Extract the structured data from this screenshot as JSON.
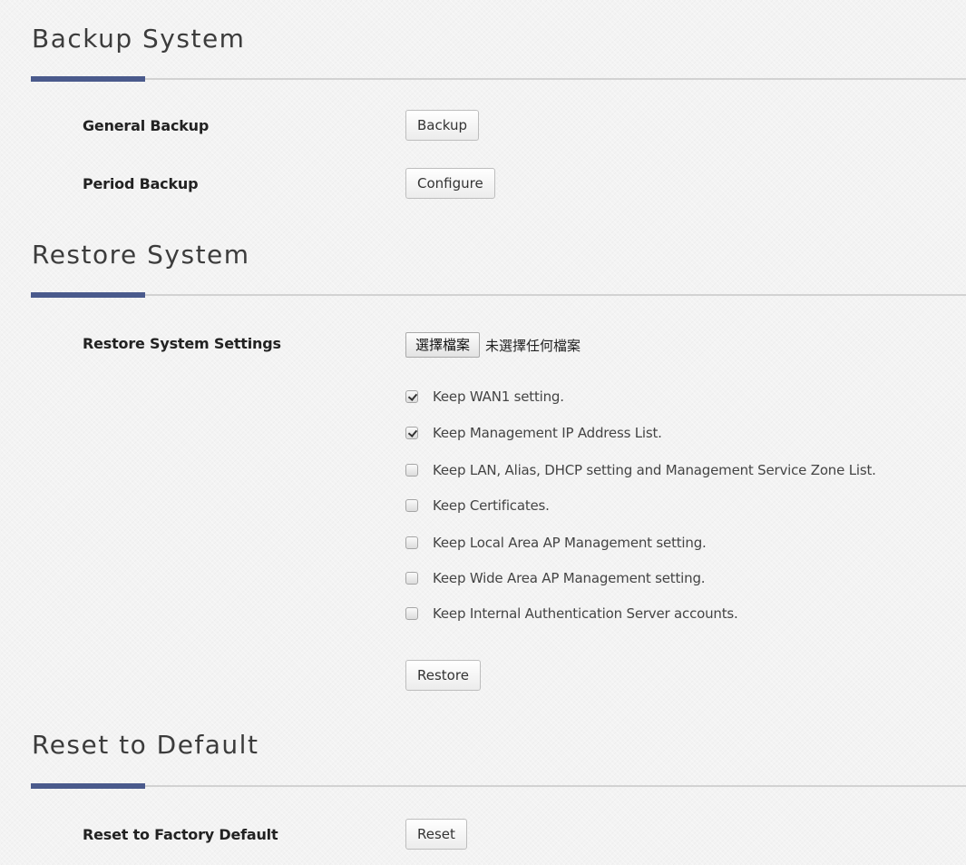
{
  "backup": {
    "title": "Backup System",
    "general_label": "General Backup",
    "general_button": "Backup",
    "period_label": "Period Backup",
    "period_button": "Configure"
  },
  "restore": {
    "title": "Restore System",
    "settings_label": "Restore System Settings",
    "file_button": "選擇檔案",
    "file_status": "未選擇任何檔案",
    "options": [
      {
        "label": "Keep WAN1 setting.",
        "checked": true
      },
      {
        "label": "Keep Management IP Address List.",
        "checked": true
      },
      {
        "label": "Keep LAN, Alias, DHCP setting and Management Service Zone List.",
        "checked": false
      },
      {
        "label": "Keep Certificates.",
        "checked": false
      },
      {
        "label": "Keep Local Area AP Management setting.",
        "checked": false
      },
      {
        "label": "Keep Wide Area AP Management setting.",
        "checked": false
      },
      {
        "label": "Keep Internal Authentication Server accounts.",
        "checked": false
      }
    ],
    "restore_button": "Restore"
  },
  "reset": {
    "title": "Reset to Default",
    "factory_label": "Reset to Factory Default",
    "reset_button": "Reset"
  },
  "colors": {
    "accent": "#4a5a8c",
    "divider": "#d2d2d2",
    "background": "#f3f3f3"
  }
}
